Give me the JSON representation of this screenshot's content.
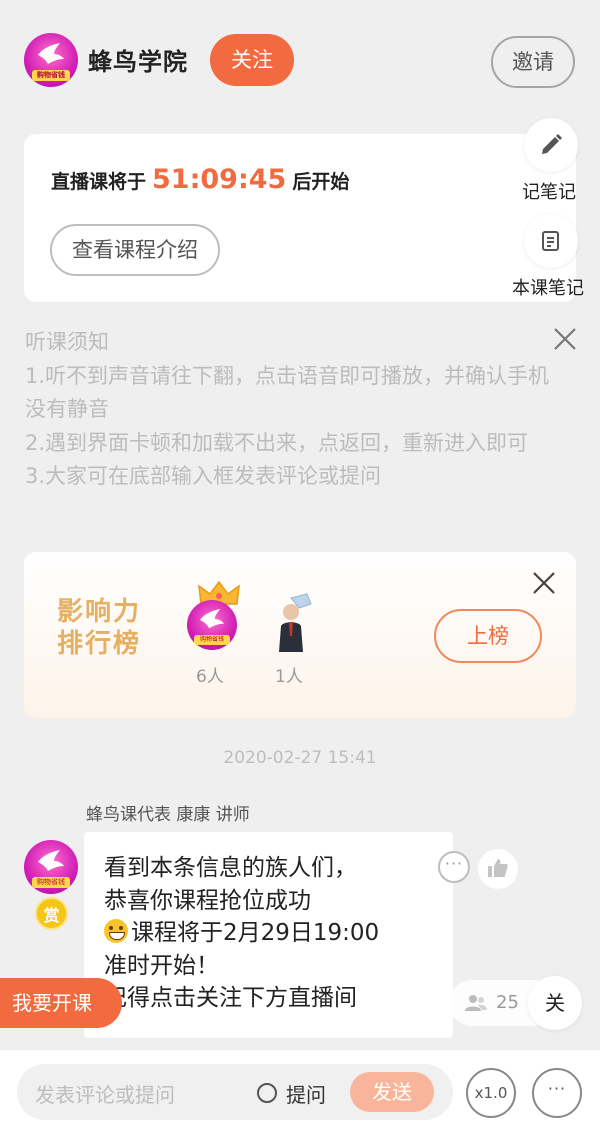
{
  "header": {
    "brand_name": "蜂鸟学院",
    "avatar_tag": "购物省钱",
    "follow_label": "关注",
    "invite_label": "邀请"
  },
  "countdown": {
    "prefix": "直播课将于",
    "time": "51:09:45",
    "suffix": "后开始",
    "intro_button": "查看课程介绍"
  },
  "side_tools": {
    "take_notes": "记笔记",
    "course_notes": "本课笔记"
  },
  "notice": {
    "title": "听课须知",
    "line1": "1.听不到声音请往下翻，点击语音即可播放，并确认手机没有静音",
    "line2": "2.遇到界面卡顿和加载不出来，点返回，重新进入即可",
    "line3": "3.大家可在底部输入框发表评论或提问"
  },
  "ranking": {
    "title_line1": "影响力",
    "title_line2": "排行榜",
    "first_count": "6人",
    "second_count": "1人",
    "list_button": "上榜"
  },
  "timestamp": "2020-02-27 15:41",
  "message": {
    "sender": "蜂鸟课代表 康康 讲师",
    "reward_badge": "赏",
    "line1": "看到本条信息的族人们，",
    "line2": "恭喜你课程抢位成功",
    "line3": "课程将于2月29日19:00",
    "line4": "准时开始！",
    "line5": "记得点击关注下方直播间"
  },
  "overlays": {
    "teach_button": "我要开课",
    "online_count": "25",
    "close_label": "关"
  },
  "bottom_bar": {
    "comment_placeholder": "发表评论或提问",
    "ask_label": "提问",
    "send_label": "发送",
    "speed_label": "x1.0",
    "more_label": "···"
  },
  "colors": {
    "accent": "#f26a3f",
    "countdown": "#f06b3f",
    "ranking_title": "#e6b062"
  }
}
